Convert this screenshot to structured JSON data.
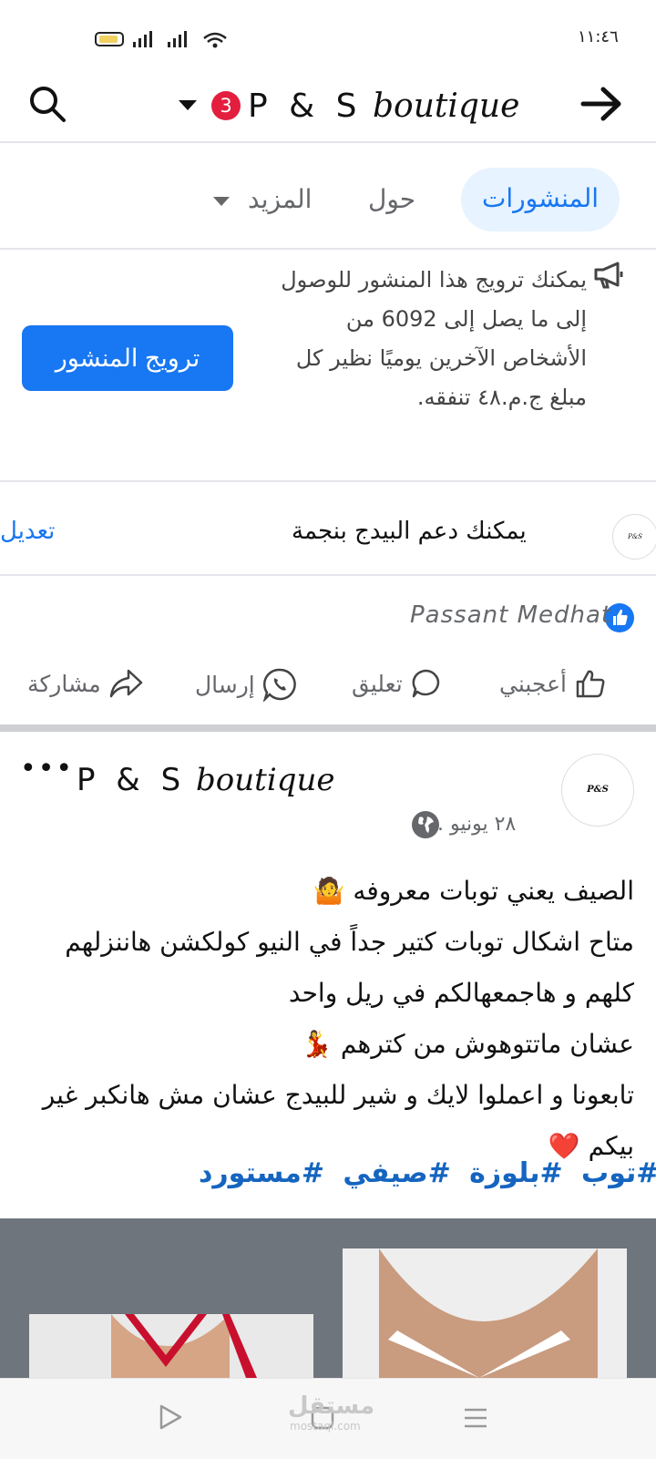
{
  "status_bar": {
    "time": "١١:٤٦"
  },
  "header": {
    "title_part1": "P & S",
    "title_part2": "boutique",
    "notification_count": "3"
  },
  "tabs": {
    "posts": "المنشورات",
    "about": "حول",
    "more": "المزيد"
  },
  "promote": {
    "text": "يمكنك ترويج هذا المنشور للوصول إلى ما يصل إلى 6092 من الأشخاص الآخرين يوميًا نظير كل مبلغ ج.م.٤٨ تنفقه.",
    "button": "ترويج المنشور"
  },
  "support": {
    "text": "يمكنك دعم البيدج بنجمة",
    "edit": "تعديل",
    "logo_text": "P&S Boutique"
  },
  "likes": {
    "liker": "Passant Medhat"
  },
  "actions": {
    "like": "أعجبني",
    "comment": "تعليق",
    "send": "إرسال",
    "share": "مشاركة"
  },
  "post": {
    "author_part1": "P & S",
    "author_part2": "boutique",
    "logo_text": "P&S Boutique",
    "date": "٢٨ يونيو .",
    "lines": [
      "الصيف يعني توبات معروفه 🤷",
      "متاح اشكال توبات كتير جداً في النيو كولكشن هاننزلهم كلهم و هاجمعهالكم في ريل واحد",
      "عشان ماتتوهوش من كترهم 💃",
      "تابعونا و اعملوا لايك و شير للبيدج عشان مش هانكبر غير بيكم ❤️"
    ],
    "hashtags": "#توب #بلوزة #صيفي #مستورد"
  },
  "watermark": {
    "text": "مستقل",
    "sub": "mostaql.com"
  },
  "colors": {
    "brand_blue": "#1877f2",
    "badge_red": "#e41e3f",
    "tab_bg": "#e7f3ff"
  }
}
